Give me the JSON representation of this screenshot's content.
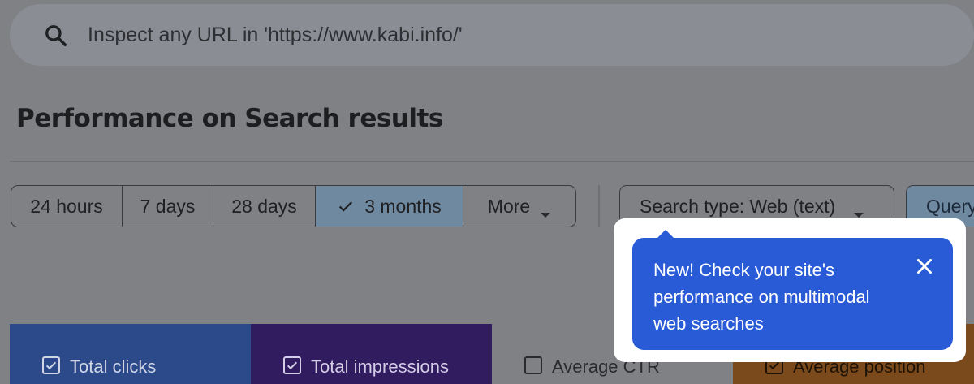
{
  "search": {
    "placeholder": "Inspect any URL in 'https://www.kabi.info/'",
    "icon": "search-icon"
  },
  "page": {
    "title": "Performance on Search results"
  },
  "date_range": {
    "options": [
      "24 hours",
      "7 days",
      "28 days",
      "3 months",
      "More"
    ],
    "selected": "3 months"
  },
  "filters": {
    "search_type_label": "Search type: Web (text)",
    "query_label": "Query"
  },
  "tooltip": {
    "text": "New! Check your site's performance on multimodal web searches",
    "close_icon": "close-icon"
  },
  "metrics": [
    {
      "label": "Total clicks",
      "checked": true,
      "color": "#2c4a8a"
    },
    {
      "label": "Total impressions",
      "checked": true,
      "color": "#311c60"
    },
    {
      "label": "Average CTR",
      "checked": false,
      "color": "#808185"
    },
    {
      "label": "Average position",
      "checked": true,
      "color": "#7a4a1c"
    }
  ],
  "colors": {
    "tooltip_bg": "#2a5bd7",
    "selected_segment": "#6f89a0",
    "backdrop": "#808185"
  }
}
